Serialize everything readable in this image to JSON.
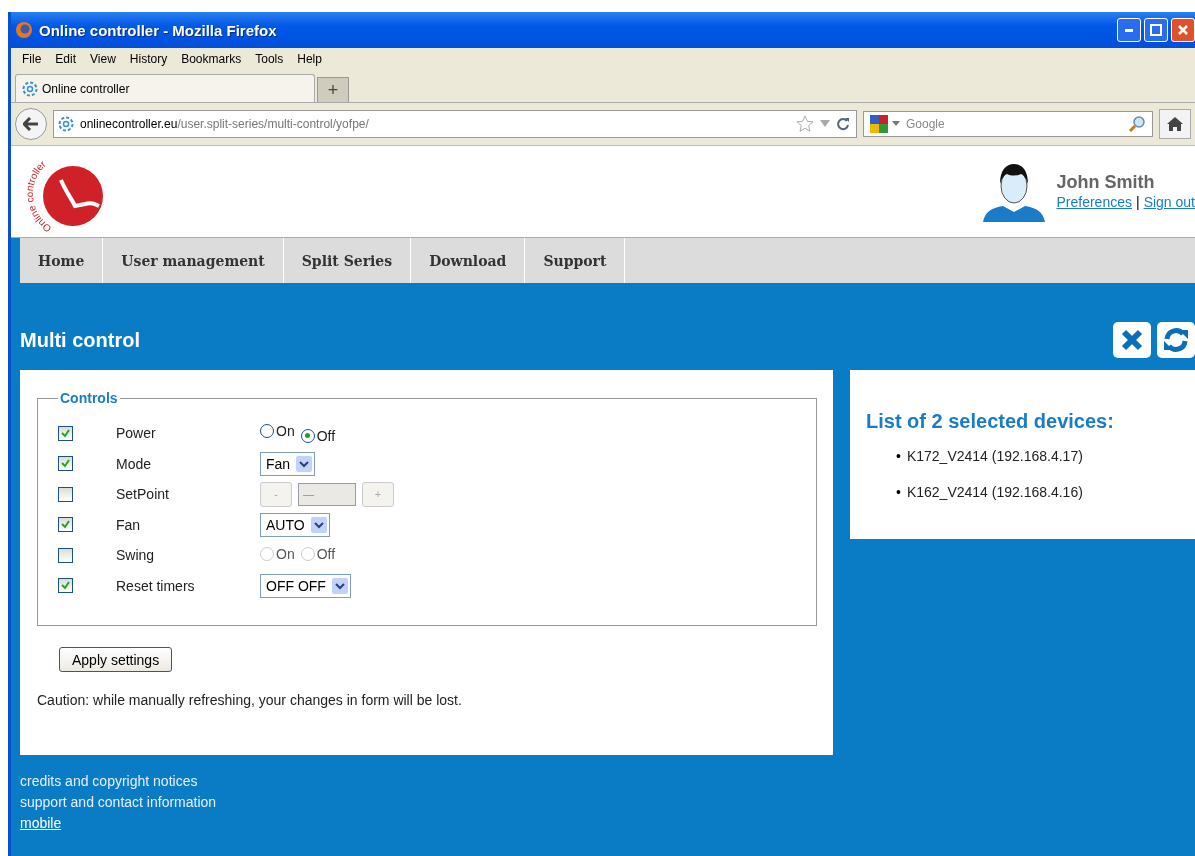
{
  "window": {
    "title": "Online controller - Mozilla Firefox"
  },
  "menu": [
    "File",
    "Edit",
    "View",
    "History",
    "Bookmarks",
    "Tools",
    "Help"
  ],
  "tabs": [
    {
      "label": "Online controller",
      "selected": true
    }
  ],
  "new_tab": "+",
  "address": {
    "domain": "onlinecontroller.eu",
    "path": "/user.split-series/multi-control/yofpe/"
  },
  "search": {
    "placeholder": "Google"
  },
  "logo": {
    "text": "Online controller"
  },
  "user": {
    "name": "John Smith",
    "links": [
      "Preferences",
      "Sign out"
    ],
    "separator": "|"
  },
  "nav": [
    {
      "label": "Home"
    },
    {
      "label": "User management"
    },
    {
      "label": "Split Series"
    },
    {
      "label": "Download"
    },
    {
      "label": "Support"
    }
  ],
  "page_title": "Multi control",
  "controls": {
    "legend": "Controls",
    "rows": [
      {
        "label": "Power",
        "checked": true,
        "kind": "radio",
        "options": [
          {
            "label": "On",
            "selected": false
          },
          {
            "label": "Off",
            "selected": true
          }
        ]
      },
      {
        "label": "Mode",
        "checked": true,
        "kind": "select",
        "value": "Fan"
      },
      {
        "label": "SetPoint",
        "checked": false,
        "kind": "stepper",
        "disabled": true,
        "minus": "-",
        "value": "—",
        "plus": "+"
      },
      {
        "label": "Fan",
        "checked": true,
        "kind": "select",
        "value": "AUTO"
      },
      {
        "label": "Swing",
        "checked": false,
        "kind": "radio",
        "disabled": true,
        "options": [
          {
            "label": "On",
            "selected": false
          },
          {
            "label": "Off",
            "selected": false
          }
        ]
      },
      {
        "label": "Reset timers",
        "checked": true,
        "kind": "select",
        "value": "OFF OFF"
      }
    ]
  },
  "apply_button": "Apply settings",
  "caution": "Caution: while manually refreshing, your changes in form will be lost.",
  "devices": {
    "title": "List of 2 selected devices:",
    "items": [
      {
        "marker": "•",
        "text": "K172_V2414 (192.168.4.17)"
      },
      {
        "marker": "•",
        "text": "K162_V2414 (192.168.4.16)"
      }
    ]
  },
  "footer": {
    "lines": [
      "credits and copyright notices",
      "support and contact information"
    ],
    "link": "mobile"
  }
}
